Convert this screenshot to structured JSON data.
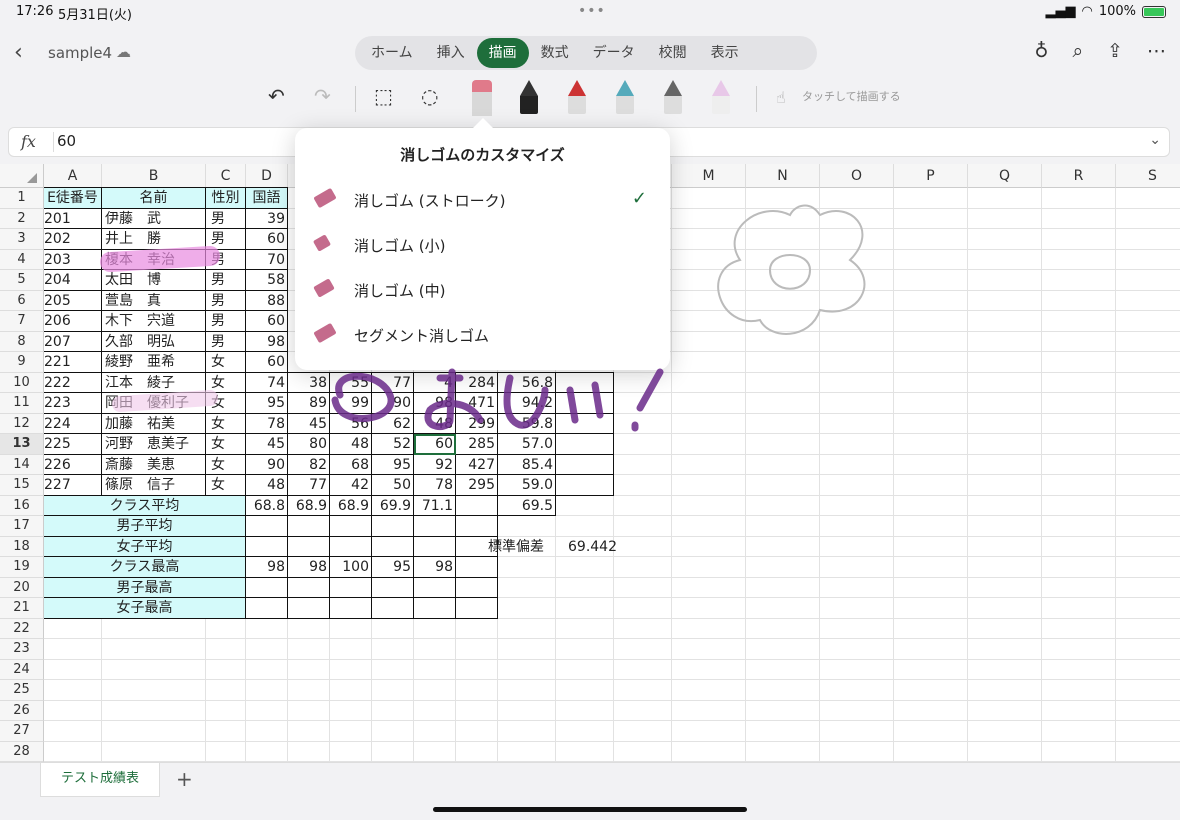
{
  "status": {
    "time": "17:26",
    "date": "5月31日(火)",
    "battery": "100%"
  },
  "doc": {
    "title": "sample4"
  },
  "tabs": [
    "ホーム",
    "挿入",
    "描画",
    "数式",
    "データ",
    "校閲",
    "表示"
  ],
  "active_tab": "描画",
  "drawbar": {
    "touch_label": "タッチして描画する"
  },
  "formula": {
    "fx": "fx",
    "value": "60"
  },
  "columns": [
    "A",
    "B",
    "C",
    "D",
    "E",
    "F",
    "G",
    "H",
    "I",
    "J",
    "K",
    "L",
    "M",
    "N",
    "O",
    "P",
    "Q",
    "R",
    "S"
  ],
  "rows": [
    "1",
    "2",
    "3",
    "4",
    "5",
    "6",
    "7",
    "8",
    "9",
    "10",
    "11",
    "12",
    "13",
    "14",
    "15",
    "16",
    "17",
    "18",
    "19",
    "20",
    "21",
    "22",
    "23",
    "24",
    "25",
    "26",
    "27",
    "28"
  ],
  "table": {
    "header": [
      "E徒番号",
      "名前",
      "性別",
      "国語"
    ],
    "students": [
      {
        "id": "201",
        "name": "伊藤　武",
        "sex": "男",
        "d": "39"
      },
      {
        "id": "202",
        "name": "井上　勝",
        "sex": "男",
        "d": "60"
      },
      {
        "id": "203",
        "name": "榎本　幸治",
        "sex": "男",
        "d": "70"
      },
      {
        "id": "204",
        "name": "太田　博",
        "sex": "男",
        "d": "58"
      },
      {
        "id": "205",
        "name": "萱島　真",
        "sex": "男",
        "d": "88"
      },
      {
        "id": "206",
        "name": "木下　宍道",
        "sex": "男",
        "d": "60"
      },
      {
        "id": "207",
        "name": "久部　明弘",
        "sex": "男",
        "d": "98"
      },
      {
        "id": "221",
        "name": "綾野　亜希",
        "sex": "女",
        "d": "60"
      },
      {
        "id": "222",
        "name": "江本　綾子",
        "sex": "女",
        "d": "74",
        "e": "38",
        "f": "55",
        "g": "77",
        "h": "4",
        "i": "284",
        "j": "56.8"
      },
      {
        "id": "223",
        "name": "岡田　優利子",
        "sex": "女",
        "d": "95",
        "e": "89",
        "f": "99",
        "g": "90",
        "h": "98",
        "i": "471",
        "j": "94.2"
      },
      {
        "id": "224",
        "name": "加藤　祐美",
        "sex": "女",
        "d": "78",
        "e": "45",
        "f": "56",
        "g": "62",
        "h": "48",
        "i": "299",
        "j": "59.8"
      },
      {
        "id": "225",
        "name": "河野　恵美子",
        "sex": "女",
        "d": "45",
        "e": "80",
        "f": "48",
        "g": "52",
        "h": "60",
        "i": "285",
        "j": "57.0"
      },
      {
        "id": "226",
        "name": "斎藤　美恵",
        "sex": "女",
        "d": "90",
        "e": "82",
        "f": "68",
        "g": "95",
        "h": "92",
        "i": "427",
        "j": "85.4"
      },
      {
        "id": "227",
        "name": "篠原　信子",
        "sex": "女",
        "d": "48",
        "e": "77",
        "f": "42",
        "g": "50",
        "h": "78",
        "i": "295",
        "j": "59.0"
      }
    ],
    "summary": [
      {
        "label": "クラス平均",
        "vals": [
          "68.8",
          "68.9",
          "68.9",
          "69.9",
          "71.1"
        ],
        "j": "69.5"
      },
      {
        "label": "男子平均",
        "vals": [
          "",
          "",
          "",
          "",
          ""
        ]
      },
      {
        "label": "女子平均",
        "vals": [
          "",
          "",
          "",
          "",
          ""
        ]
      },
      {
        "label": "クラス最高",
        "vals": [
          "98",
          "98",
          "100",
          "95",
          "98"
        ]
      },
      {
        "label": "男子最高",
        "vals": [
          "",
          "",
          "",
          "",
          ""
        ]
      },
      {
        "label": "女子最高",
        "vals": [
          "",
          "",
          "",
          "",
          ""
        ]
      }
    ],
    "stddev_label": "標準偏差",
    "stddev_value": "69.442"
  },
  "popover": {
    "title": "消しゴムのカスタマイズ",
    "items": [
      "消しゴム (ストローク)",
      "消しゴム (小)",
      "消しゴム (中)",
      "セグメント消しゴム"
    ],
    "checked": "✓"
  },
  "sheet": {
    "tab": "テスト成績表",
    "add": "+"
  },
  "colors": {
    "accent": "#1e6e3b",
    "cyan": "#d4fafa",
    "ink_purple": "#6a2a8a",
    "highlight_pink": "#e88ae0"
  }
}
